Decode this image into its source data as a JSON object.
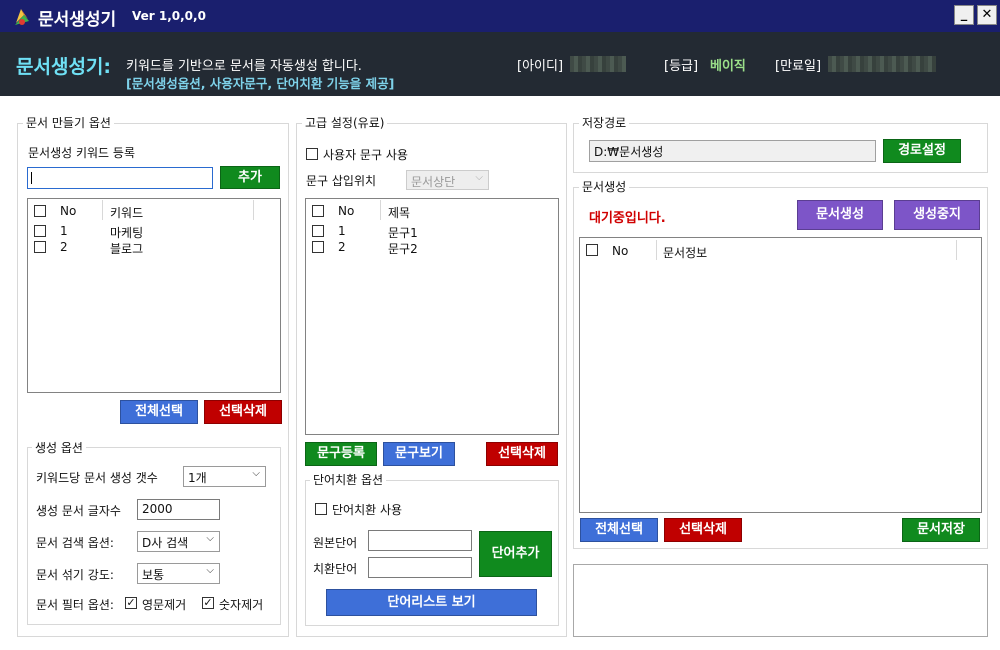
{
  "titlebar": {
    "title": "문서생성기",
    "version": "Ver 1,0,0,0",
    "minimize": "_",
    "close": "✕"
  },
  "header": {
    "brand": "문서생성기:",
    "desc1": "키워드를 기반으로 문서를 자동생성 합니다.",
    "desc2": "[문서생성옵션, 사용자문구, 단어치환 기능을 제공]",
    "id_label": "[아이디]",
    "grade_label": "[등급]",
    "grade_value": "베이직",
    "expiry_label": "[만료일]"
  },
  "left": {
    "group_title": "문서 만들기 옵션",
    "keyword_register_label": "문서생성 키워드 등록",
    "keyword_input_value": "",
    "add_button": "추가",
    "list_columns": [
      "No",
      "키워드"
    ],
    "keywords": [
      {
        "no": "1",
        "keyword": "마케팅"
      },
      {
        "no": "2",
        "keyword": "블로그"
      }
    ],
    "select_all_button": "전체선택",
    "delete_selected_button": "선택삭제",
    "gen_options": {
      "title": "생성 옵션",
      "count_label": "키워드당 문서 생성 갯수",
      "count_value": "1개",
      "chars_label": "생성 문서 글자수",
      "chars_value": "2000",
      "search_label": "문서 검색 옵션:",
      "search_value": "D사 검색",
      "shuffle_label": "문서 섞기 강도:",
      "shuffle_value": "보통",
      "filter_label": "문서 필터 옵션:",
      "filter_english": "영문제거",
      "filter_number": "숫자제거"
    }
  },
  "middle": {
    "group_title": "고급 설정(유료)",
    "use_user_phrase": "사용자 문구 사용",
    "insert_position_label": "문구 삽입위치",
    "insert_position_value": "문서상단",
    "list_columns": [
      "No",
      "제목"
    ],
    "phrases": [
      {
        "no": "1",
        "title": "문구1"
      },
      {
        "no": "2",
        "title": "문구2"
      }
    ],
    "register_button": "문구등록",
    "view_button": "문구보기",
    "delete_button": "선택삭제",
    "word_replace": {
      "title": "단어치환 옵션",
      "use_label": "단어치환 사용",
      "source_label": "원본단어",
      "replace_label": "치환단어",
      "add_button": "단어추가",
      "view_list_button": "단어리스트 보기"
    }
  },
  "right": {
    "save_path_title": "저장경로",
    "save_path_value": "D:₩문서생성",
    "path_button": "경로설정",
    "doc_gen_title": "문서생성",
    "status_text": "대기중입니다.",
    "generate_button": "문서생성",
    "stop_button": "생성중지",
    "list_columns": [
      "No",
      "문서정보"
    ],
    "select_all_button": "전체선택",
    "delete_selected_button": "선택삭제",
    "save_button": "문서저장"
  },
  "colors": {
    "titlebar": "#1a1f6e",
    "header_bg": "#232a33",
    "accent_cyan": "#6fe0f5",
    "grade_green": "#9be08a",
    "btn_green": "#108a1e",
    "btn_blue": "#3e6fd8",
    "btn_red": "#c00000",
    "btn_purple": "#7d55c8",
    "status_red": "#d00000"
  }
}
